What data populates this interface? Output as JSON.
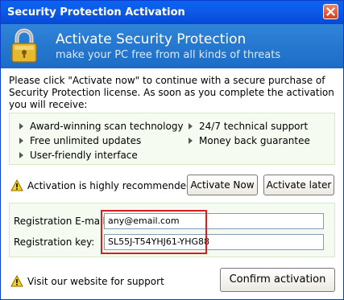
{
  "window": {
    "title": "Security Protection Activation"
  },
  "banner": {
    "title": "Activate Security Protection",
    "subtitle": "make your PC free from all kinds of threats"
  },
  "intro": "Please click \"Activate now\" to continue with a secure purchase of Security Protection license. As soon as you complete the activation you will receive:",
  "features": {
    "left": [
      "Award-winning scan technology",
      "Free unlimited updates",
      "User-friendly interface"
    ],
    "right": [
      "24/7 technical support",
      "Money back guarantee"
    ]
  },
  "recommendation": {
    "text": "Activation is highly recommended",
    "activate_now": "Activate Now",
    "activate_later": "Activate later"
  },
  "registration": {
    "email_label": "Registration E-mail:",
    "email_value": "any@email.com",
    "key_label": "Registration key:",
    "key_value": "SL55J-T54YHJ61-YHG88"
  },
  "footer": {
    "support_text": "Visit our website for support",
    "confirm_label": "Confirm activation"
  },
  "colors": {
    "titlebar": "#0a5ce8",
    "banner": "#2878d0",
    "highlight": "#d02020",
    "panel_bg": "#f6fbf1"
  },
  "icons": {
    "banner": "lock-icon",
    "close": "close-icon",
    "warning": "warning-icon"
  }
}
